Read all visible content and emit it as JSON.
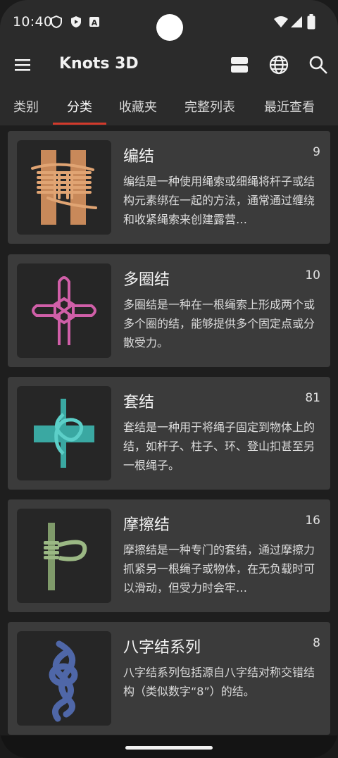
{
  "status": {
    "time": "10:40",
    "icons": [
      "shield-icon",
      "play-protect-icon",
      "a-icon"
    ],
    "right_icons": [
      "wifi-icon",
      "signal-icon",
      "battery-icon"
    ]
  },
  "appbar": {
    "title": "Knots 3D",
    "icons": [
      "menu-icon",
      "view-toggle-icon",
      "globe-icon",
      "search-icon"
    ]
  },
  "tabs": [
    {
      "label": "类别"
    },
    {
      "label": "分类",
      "active": true
    },
    {
      "label": "收藏夹"
    },
    {
      "label": "完整列表"
    },
    {
      "label": "最近查看"
    }
  ],
  "colors": {
    "accent": "#d33a2c",
    "card": "#3b3b3b",
    "thumb_bg": "#262626"
  },
  "categories": [
    {
      "title": "编结",
      "count": "9",
      "desc": "编结是一种使用绳索或细绳将杆子或结构元素绑在一起的方法，通常通过缠绕和收紧绳索来创建露营…",
      "icon": "lashing-knot-icon",
      "color": "#c8895a"
    },
    {
      "title": "多圈结",
      "count": "10",
      "desc": "多圈结是一种在一根绳索上形成两个或多个圈的结，能够提供多个固定点或分散受力。",
      "icon": "multi-loop-knot-icon",
      "color": "#d05fa8"
    },
    {
      "title": "套结",
      "count": "81",
      "desc": "套结是一种用于将绳子固定到物体上的结，如杆子、柱子、环、登山扣甚至另一根绳子。",
      "icon": "hitch-knot-icon",
      "color": "#3aa8a2"
    },
    {
      "title": "摩擦结",
      "count": "16",
      "desc": "摩擦结是一种专门的套结，通过摩擦力抓紧另一根绳子或物体，在无负载时可以滑动，但受力时会牢…",
      "icon": "friction-hitch-icon",
      "color": "#7f9a6a"
    },
    {
      "title": "八字结系列",
      "count": "8",
      "desc": "八字结系列包括源自八字结对称交错结构（类似数字“8”）的结。",
      "icon": "figure-eight-knot-icon",
      "color": "#4f67a8"
    }
  ]
}
